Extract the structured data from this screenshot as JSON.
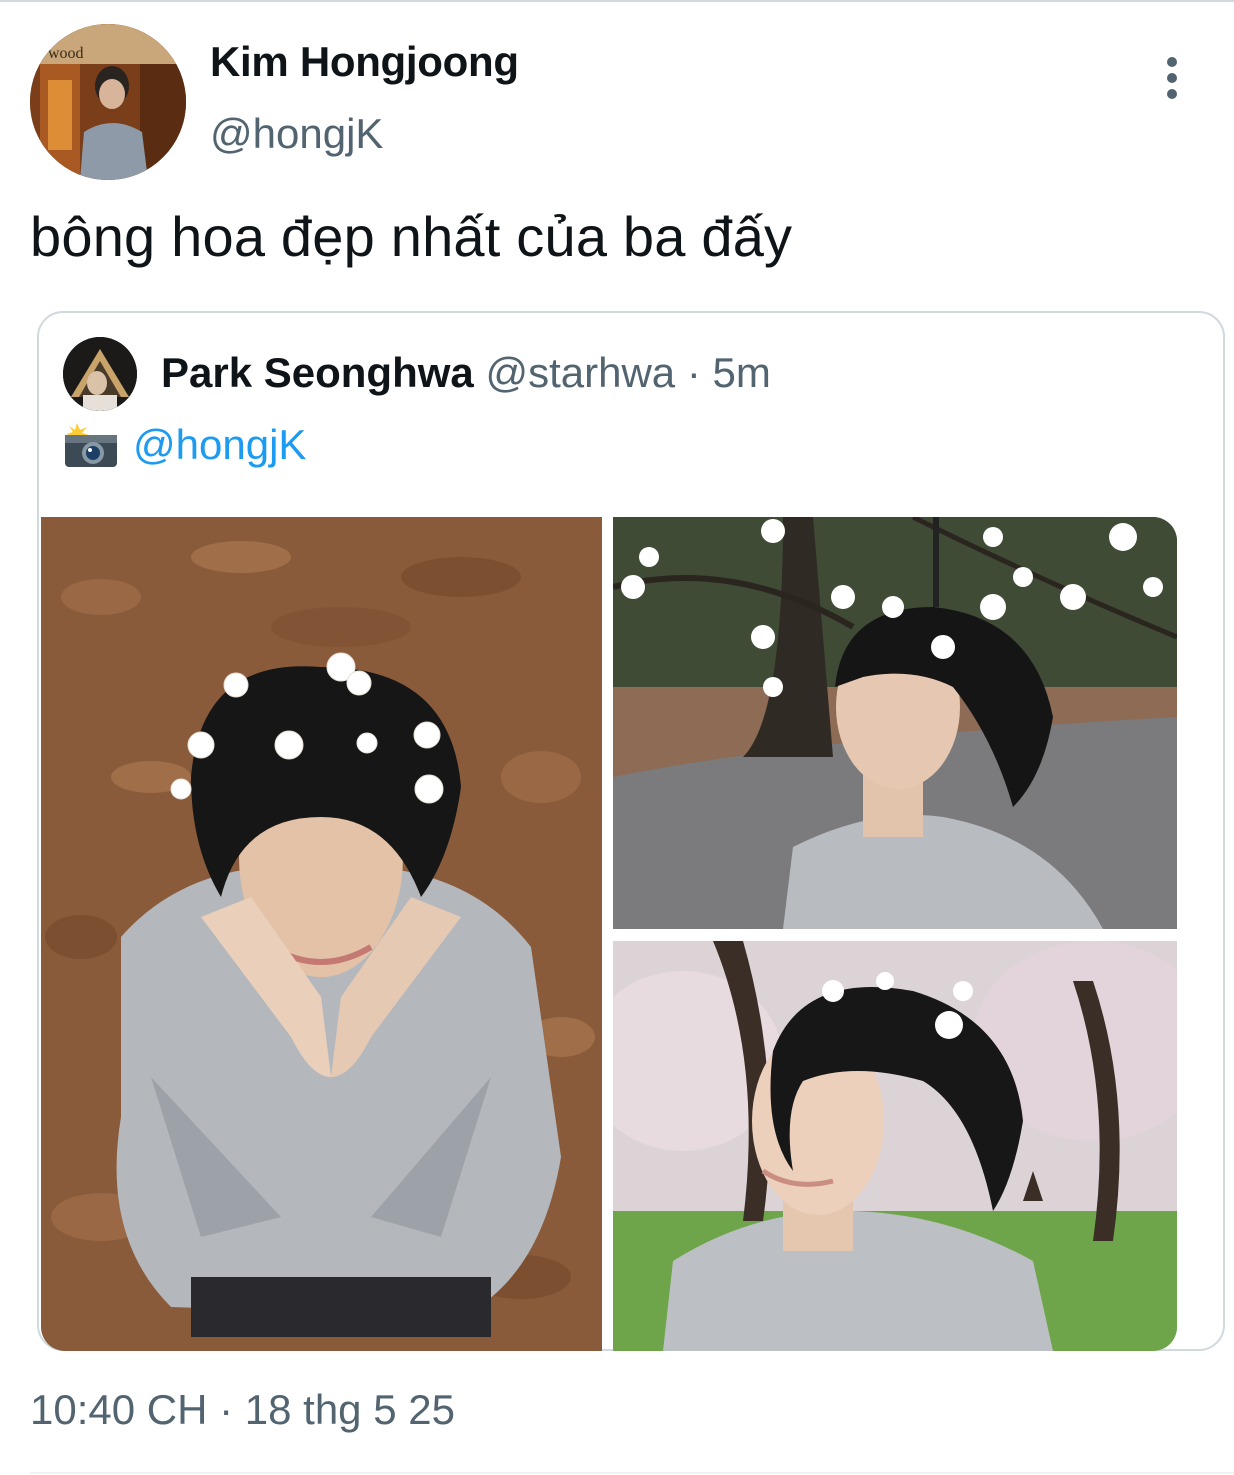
{
  "tweet": {
    "author": {
      "name": "Kim Hongjoong",
      "handle": "@hongjK",
      "avatar_sign": "wood"
    },
    "text": "bông hoa đẹp nhất của ba đấy",
    "timestamp": "10:40 CH · 18 thg 5 25"
  },
  "quoted_tweet": {
    "author_name": "Park Seonghwa",
    "author_handle": "@starhwa",
    "separator": "·",
    "time_ago": "5m",
    "mention": "@hongjK",
    "icon": "camera-flash-icon",
    "photos": [
      "photo-leaves-hands",
      "photo-tree-profile",
      "photo-cherry-park"
    ]
  },
  "colors": {
    "text_primary": "#0f1419",
    "text_secondary": "#536471",
    "link": "#1d9bf0",
    "border": "#cfd9de"
  }
}
